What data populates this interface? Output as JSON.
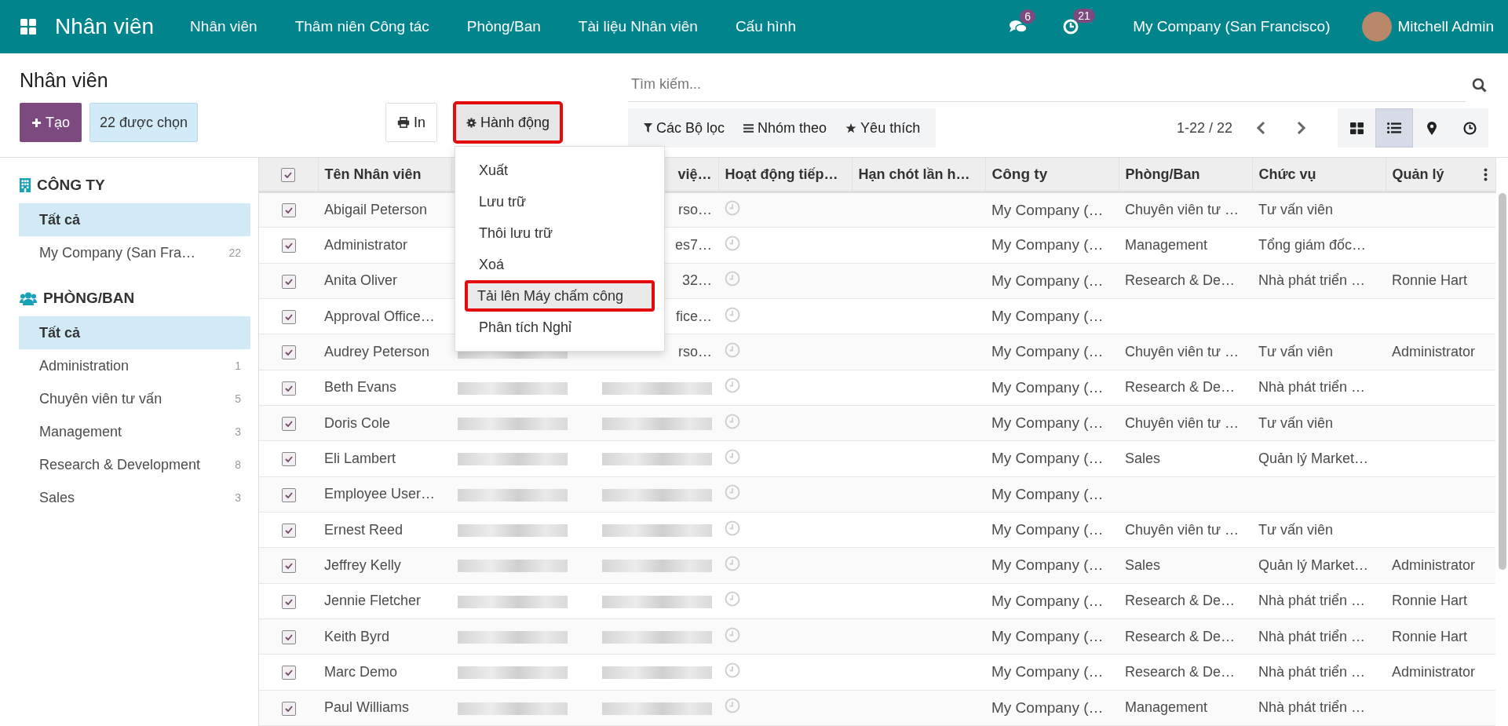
{
  "navbar": {
    "app_title": "Nhân viên",
    "menus": [
      "Nhân viên",
      "Thâm niên Công tác",
      "Phòng/Ban",
      "Tài liệu Nhân viên",
      "Cấu hình"
    ],
    "messages_badge": "6",
    "activities_badge": "21",
    "company": "My Company (San Francisco)",
    "user": "Mitchell Admin"
  },
  "control_panel": {
    "title": "Nhân viên",
    "create_button": "Tạo",
    "selection": "22 được chọn",
    "print_button": "In",
    "action_button": {
      "label": "Hành động",
      "highlighted": true
    },
    "action_menu": [
      {
        "label": "Xuất",
        "highlighted": false
      },
      {
        "label": "Lưu trữ",
        "highlighted": false
      },
      {
        "label": "Thôi lưu trữ",
        "highlighted": false
      },
      {
        "label": "Xoá",
        "highlighted": false
      },
      {
        "label": "Tải lên Máy chấm công",
        "highlighted": true
      },
      {
        "label": "Phân tích Nghỉ",
        "highlighted": false
      }
    ],
    "search": {
      "placeholder": "Tìm kiếm..."
    },
    "filters": "Các Bộ lọc",
    "group_by": "Nhóm theo",
    "favorites": "Yêu thích",
    "pager": "1-22 / 22",
    "views": [
      {
        "kind": "kanban",
        "selected": false
      },
      {
        "kind": "list",
        "selected": true
      },
      {
        "kind": "map",
        "selected": false
      },
      {
        "kind": "activity",
        "selected": false
      }
    ]
  },
  "sidebar": [
    {
      "kind": "company",
      "title": "CÔNG TY",
      "items": [
        {
          "label": "Tất cả",
          "selected": true
        },
        {
          "label": "My Company (San Fra…",
          "count": "22",
          "selected": false
        }
      ]
    },
    {
      "kind": "department",
      "title": "PHÒNG/BAN",
      "items": [
        {
          "label": "Tất cả",
          "selected": true
        },
        {
          "label": "Administration",
          "count": "1",
          "selected": false
        },
        {
          "label": "Chuyên viên tư vấn",
          "count": "5",
          "selected": false
        },
        {
          "label": "Management",
          "count": "3",
          "selected": false
        },
        {
          "label": "Research & Development",
          "count": "8",
          "selected": false
        },
        {
          "label": "Sales",
          "count": "3",
          "selected": false
        }
      ]
    }
  ],
  "table": {
    "all_checked": true,
    "columns": [
      {
        "kind": "name",
        "label": "Tên Nhân viên"
      },
      {
        "kind": "blurred"
      },
      {
        "kind": "covered",
        "label": "việ…"
      },
      {
        "kind": "activity",
        "label": "Hoạt động tiếp…"
      },
      {
        "kind": "deadline",
        "label": "Hạn chót lần h…"
      },
      {
        "kind": "company",
        "label": "Công ty"
      },
      {
        "kind": "department",
        "label": "Phòng/Ban"
      },
      {
        "kind": "job",
        "label": "Chức vụ"
      },
      {
        "kind": "manager",
        "label": "Quản lý"
      }
    ],
    "rows": [
      {
        "checked": true,
        "name": "Abigail Peterson",
        "column_4": "rso…",
        "company": "My Company (…",
        "department": "Chuyên viên tư …",
        "job": "Tư vấn viên"
      },
      {
        "checked": true,
        "name": "Administrator",
        "column_4": "es7…",
        "company": "My Company (…",
        "department": "Management",
        "job": "Tổng giám đốc…"
      },
      {
        "checked": true,
        "name": "Anita Oliver",
        "column_4": "32…",
        "company": "My Company (…",
        "department": "Research & De…",
        "job": "Nhà phát triển …",
        "manager": "Ronnie Hart"
      },
      {
        "checked": true,
        "name": "Approval Office…",
        "column_4": "fice…",
        "company": "My Company (…"
      },
      {
        "checked": true,
        "name": "Audrey Peterson",
        "column_4": "rso…",
        "company": "My Company (…",
        "department": "Chuyên viên tư …",
        "job": "Tư vấn viên",
        "manager": "Administrator"
      },
      {
        "checked": true,
        "name": "Beth Evans",
        "company": "My Company (…",
        "department": "Research & De…",
        "job": "Nhà phát triển …"
      },
      {
        "checked": true,
        "name": "Doris Cole",
        "company": "My Company (…",
        "department": "Chuyên viên tư …",
        "job": "Tư vấn viên"
      },
      {
        "checked": true,
        "name": "Eli Lambert",
        "company": "My Company (…",
        "department": "Sales",
        "job": "Quản lý Market…"
      },
      {
        "checked": true,
        "name": "Employee User…",
        "company": "My Company (…"
      },
      {
        "checked": true,
        "name": "Ernest Reed",
        "company": "My Company (…",
        "department": "Chuyên viên tư …",
        "job": "Tư vấn viên"
      },
      {
        "checked": true,
        "name": "Jeffrey Kelly",
        "company": "My Company (…",
        "department": "Sales",
        "job": "Quản lý Market…",
        "manager": "Administrator"
      },
      {
        "checked": true,
        "name": "Jennie Fletcher",
        "company": "My Company (…",
        "department": "Research & De…",
        "job": "Nhà phát triển …",
        "manager": "Ronnie Hart"
      },
      {
        "checked": true,
        "name": "Keith Byrd",
        "company": "My Company (…",
        "department": "Research & De…",
        "job": "Nhà phát triển …",
        "manager": "Ronnie Hart"
      },
      {
        "checked": true,
        "name": "Marc Demo",
        "company": "My Company (…",
        "department": "Research & De…",
        "job": "Nhà phát triển …",
        "manager": "Administrator"
      },
      {
        "checked": true,
        "name": "Paul Williams",
        "company": "My Company (…",
        "department": "Management",
        "job": "Nhà phát triển …"
      }
    ]
  }
}
